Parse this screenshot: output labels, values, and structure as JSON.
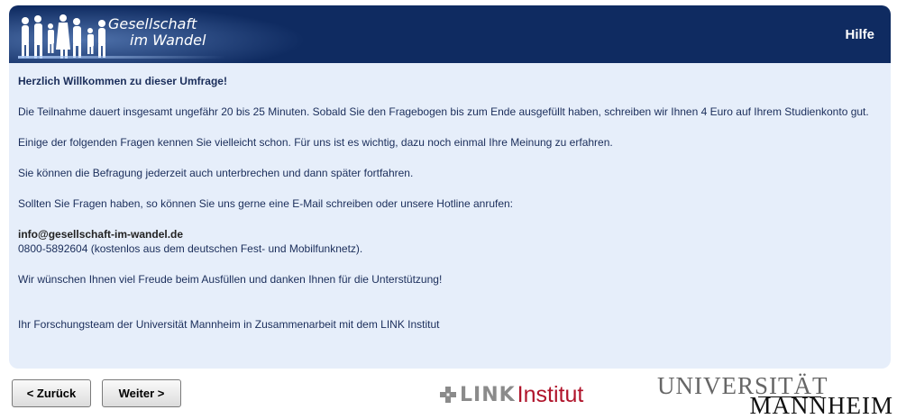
{
  "header": {
    "logo_line1": "Gesellschaft",
    "logo_line2": "im Wandel",
    "help_label": "Hilfe",
    "bg_color": "#0f2b61"
  },
  "content": {
    "welcome": "Herzlich Willkommen zu dieser Umfrage!",
    "p1": "Die Teilnahme dauert insgesamt ungefähr 20 bis 25 Minuten. Sobald Sie den Fragebogen bis zum Ende ausgefüllt haben, schreiben wir Ihnen 4 Euro auf Ihrem Studienkonto gut.",
    "p2": "Einige der folgenden Fragen kennen Sie vielleicht schon. Für uns ist es wichtig, dazu noch einmal Ihre Meinung zu erfahren.",
    "p3": "Sie können die Befragung jederzeit auch unterbrechen und dann später fortfahren.",
    "p4": "Sollten Sie Fragen haben, so können Sie uns gerne eine E-Mail schreiben oder unsere Hotline anrufen:",
    "email": "info@gesellschaft-im-wandel.de",
    "phone": "0800-5892604 (kostenlos aus dem deutschen Fest- und Mobilfunknetz).",
    "p5": "Wir wünschen Ihnen viel Freude beim Ausfüllen und danken Ihnen für die Unterstützung!",
    "p6": "Ihr Forschungsteam der Universität Mannheim in Zusammenarbeit mit dem LINK Institut",
    "bg_color": "#e6eefa"
  },
  "nav": {
    "back_label": "< Zurück",
    "next_label": "Weiter >"
  },
  "footer": {
    "link_word": "LINK",
    "link_institut": "Institut",
    "uni_line1": "UNIVERSITÄT",
    "uni_line2": "MANNHEIM",
    "link_red": "#b0142b"
  }
}
